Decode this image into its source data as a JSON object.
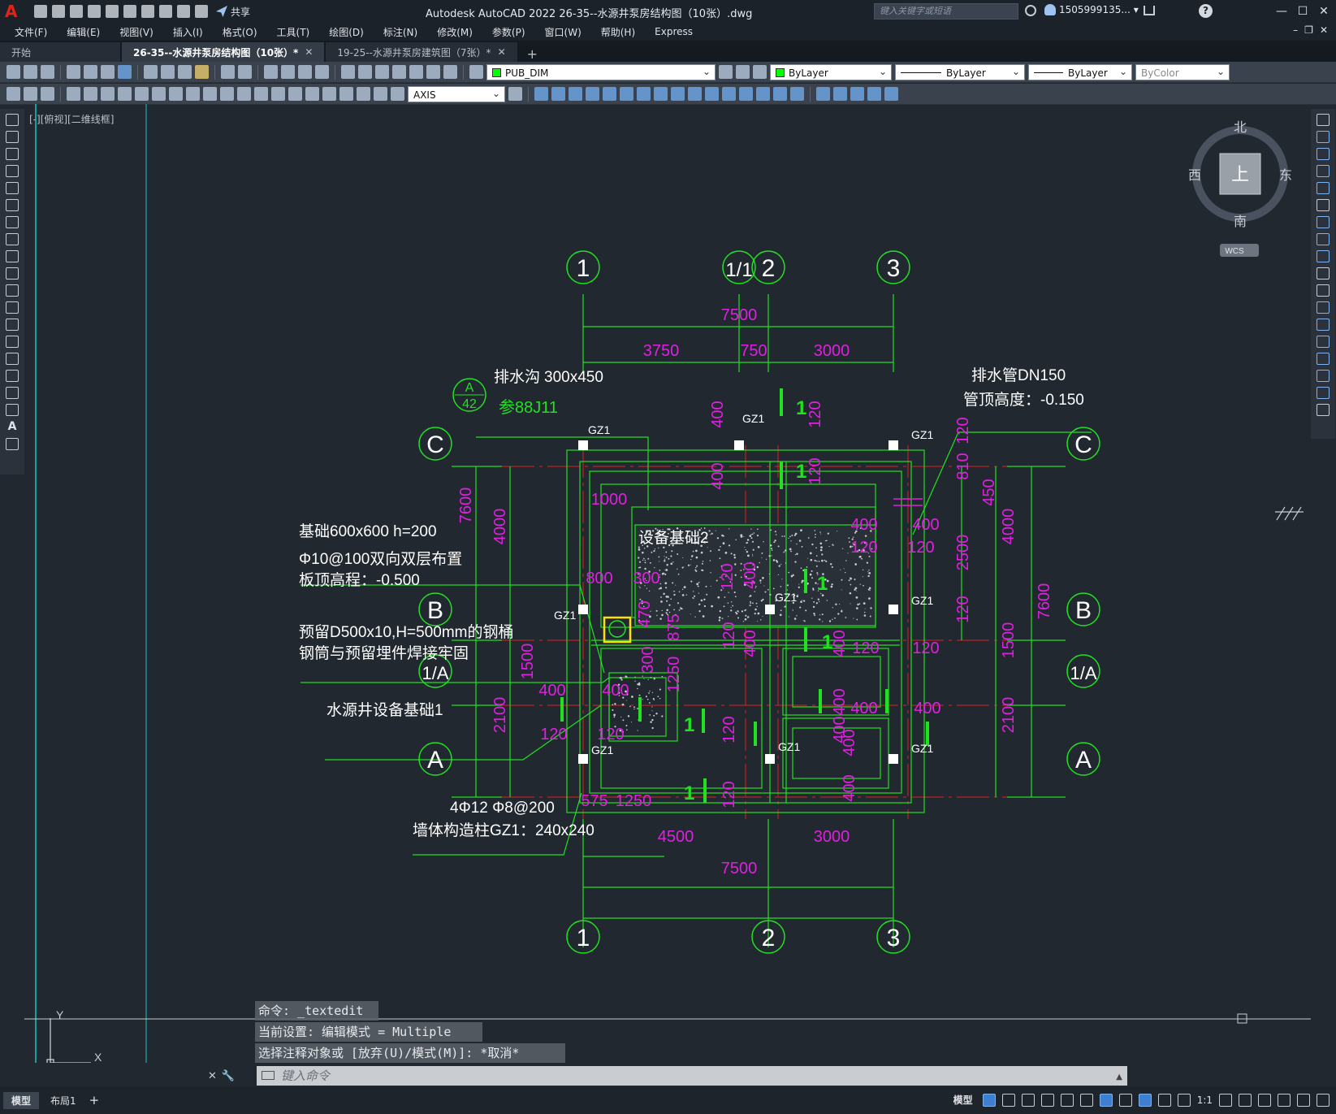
{
  "app": {
    "logo": "A",
    "title": "Autodesk AutoCAD 2022    26-35--水源井泵房结构图（10张）.dwg",
    "share_label": "共享",
    "search_placeholder": "键入关键字或短语",
    "user": "1505999135...",
    "help": "?"
  },
  "menu": [
    "文件(F)",
    "编辑(E)",
    "视图(V)",
    "插入(I)",
    "格式(O)",
    "工具(T)",
    "绘图(D)",
    "标注(N)",
    "修改(M)",
    "参数(P)",
    "窗口(W)",
    "帮助(H)",
    "Express"
  ],
  "tabs": [
    {
      "label": "开始",
      "active": false,
      "closable": false
    },
    {
      "label": "26-35--水源井泵房结构图（10张）*",
      "active": true,
      "closable": true
    },
    {
      "label": "19-25--水源井泵房建筑图（7张）*",
      "active": false,
      "closable": true
    }
  ],
  "toolbar": {
    "layer": "PUB_DIM",
    "color": "ByLayer",
    "linetype": "ByLayer",
    "lineweight": "ByLayer",
    "plotstyle": "ByColor",
    "dimstyle": "AXIS",
    "layer_color": "#00ff00"
  },
  "viewport": {
    "label": "[-][俯视][二维线框]"
  },
  "viewcube": {
    "north": "北",
    "south": "南",
    "east": "东",
    "west": "西",
    "face": "上",
    "wcs": "WCS"
  },
  "ucs": {
    "x": "X",
    "y": "Y"
  },
  "drawing": {
    "grid_top": [
      "1",
      "1/1",
      "2",
      "3"
    ],
    "grid_bottom": [
      "1",
      "2",
      "3"
    ],
    "grid_rows": [
      "C",
      "B",
      "1/A",
      "A"
    ],
    "dims_top": {
      "total": "7500",
      "d1": "3750",
      "d2": "750",
      "d3": "3000"
    },
    "dims_bottom": {
      "d1": "4500",
      "d2": "3000",
      "total": "7500",
      "s1": "575",
      "s2": "1250"
    },
    "dims_left": {
      "total": "7600",
      "d1": "4000",
      "d2": "1500",
      "d3": "2100"
    },
    "dims_right": {
      "total": "7600",
      "d1": "4000",
      "d2": "1500",
      "d3": "2100",
      "r1": "810",
      "r2": "450",
      "r3": "2500",
      "r4": "120",
      "r5": "120"
    },
    "labels": {
      "drain_ditch": "排水沟",
      "drain_ditch_size": "300x450",
      "detail_ref_top": "A",
      "detail_ref_bottom": "42",
      "detail_ref_std": "参88J11",
      "drain_pipe": "排水管DN150",
      "pipe_top_elev": "管顶高度：-0.150",
      "foundation": "基础600x600  h=200",
      "rebar": "Φ10@100双向双层布置",
      "slab_elev": "板顶高程：-0.500",
      "steel_drum": "预留D500x10,H=500mm的钢桶",
      "drum_weld": "钢筒与预留埋件焊接牢固",
      "well_found": "水源井设备基础1",
      "equip_found2": "设备基础2",
      "col_rebar": "4Φ12    Φ8@200",
      "col_spec": "墙体构造柱GZ1：240x240",
      "gz": "GZ1",
      "section_mark": "1"
    },
    "inner_dims": {
      "v400a": "400",
      "v120a": "120",
      "v400b": "400",
      "v120b": "120",
      "h1000": "1000",
      "h800": "800",
      "h300": "300",
      "h400r": "400",
      "h120r": "120",
      "v470": "470",
      "v875": "875",
      "v1250": "1250",
      "v300": "300",
      "h400a": "400",
      "h400b": "400",
      "h120a": "120",
      "h120b": "120",
      "v120c": "120",
      "v400c": "400",
      "v120d": "120",
      "v400d": "400",
      "h120c": "120",
      "h120d": "120",
      "v400e": "400",
      "v400f": "400",
      "h400c": "400",
      "h400d": "400",
      "v120e": "120",
      "v400g": "400"
    }
  },
  "command": {
    "history": [
      "命令: _textedit",
      "当前设置: 编辑模式 = Multiple",
      "选择注释对象或 [放弃(U)/模式(M)]: *取消*"
    ],
    "prompt": "键入命令"
  },
  "status": {
    "layouts": [
      "模型",
      "布局1"
    ],
    "model_label": "模型",
    "scale": "1:1"
  }
}
